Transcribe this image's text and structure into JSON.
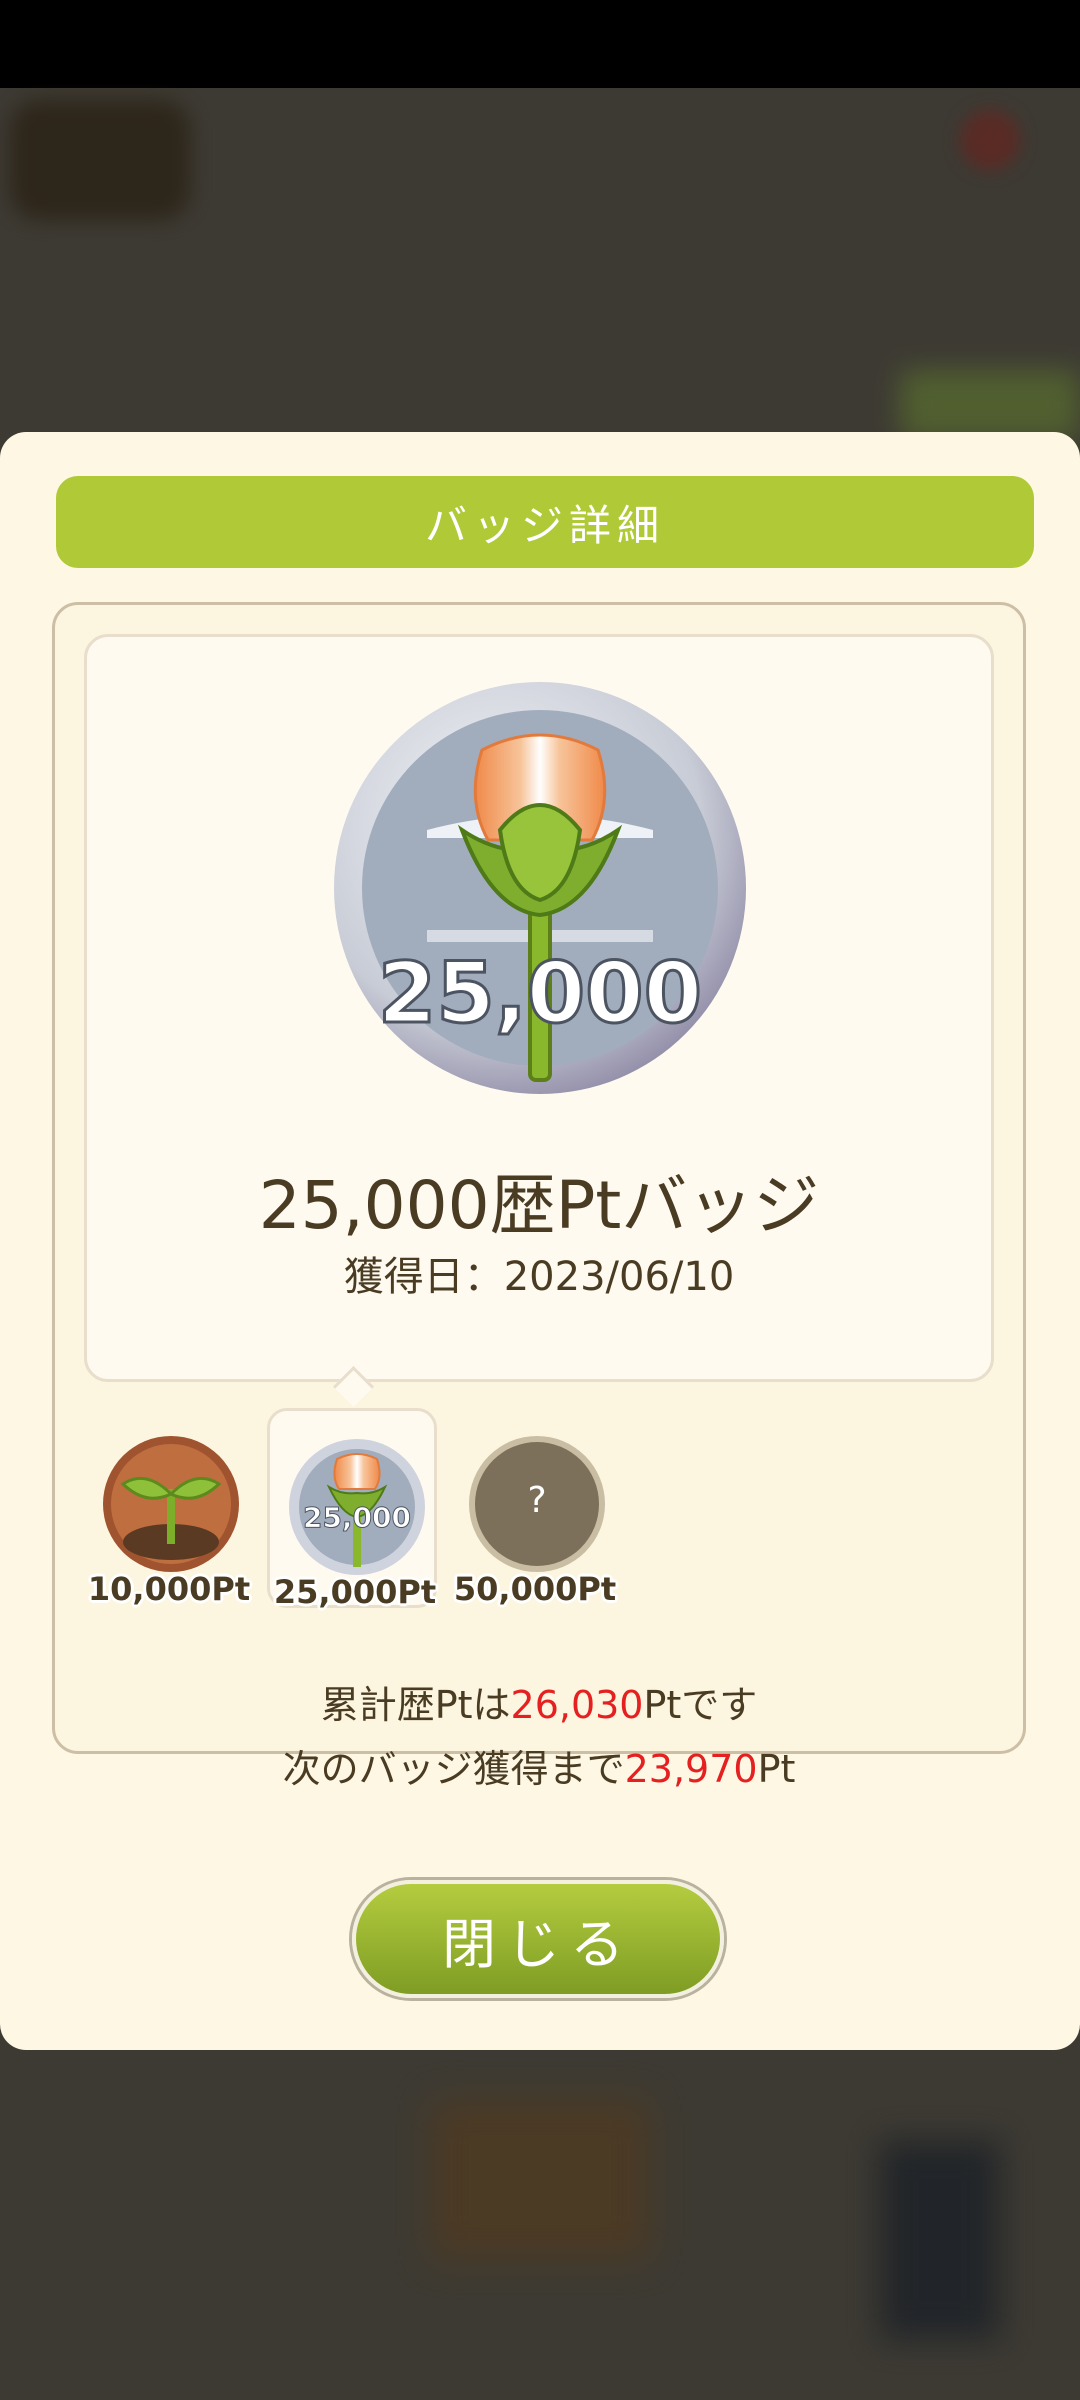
{
  "dialog": {
    "title": "バッジ詳細",
    "badge": {
      "number": "25,000",
      "name": "25,000歴Ptバッジ",
      "date": "獲得日：2023/06/10"
    },
    "thumbnails": [
      {
        "label": "10,000Pt",
        "state": "earned",
        "icon": "sprout-icon"
      },
      {
        "label": "25,000Pt",
        "state": "selected",
        "number": "25,000",
        "icon": "tulip-icon"
      },
      {
        "label": "50,000Pt",
        "state": "locked",
        "symbol": "?"
      }
    ],
    "summary": {
      "line1_prefix": "累計歴Ptは",
      "line1_value": "26,030",
      "line1_suffix": "Ptです",
      "line2_prefix": "次のバッジ獲得まで",
      "line2_value": "23,970",
      "line2_suffix": "Pt"
    },
    "close_label": "閉じる"
  },
  "colors": {
    "accent_green": "#afc937",
    "highlight_red": "#e52020",
    "text_brown": "#4a3b23"
  }
}
